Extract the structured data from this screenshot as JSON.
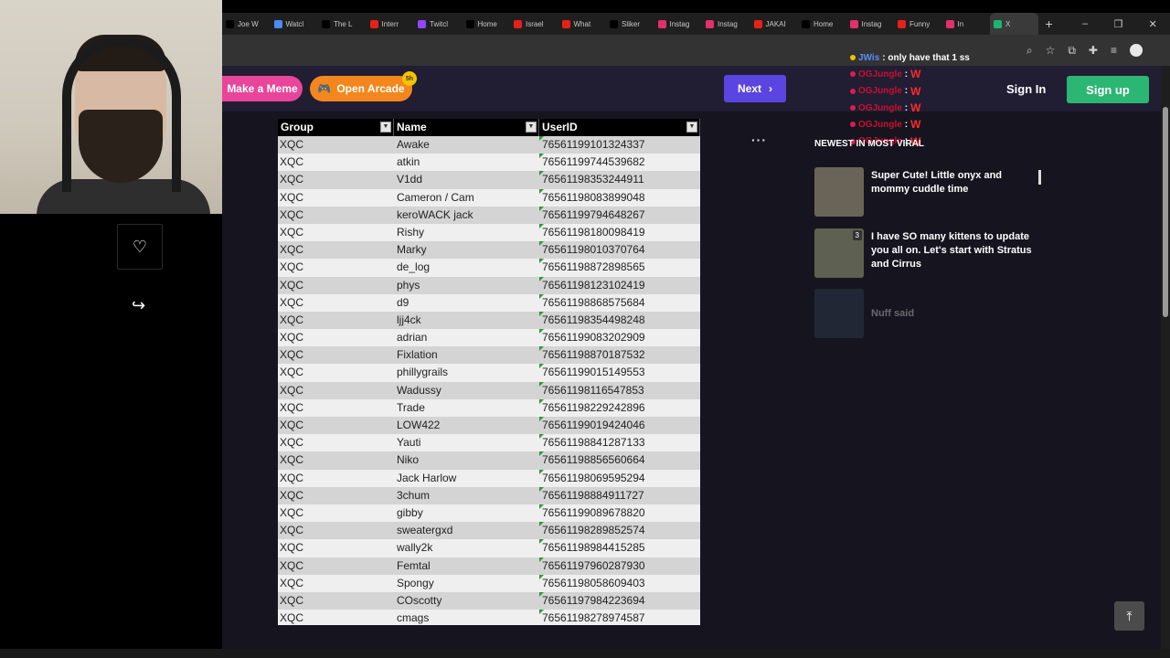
{
  "browser": {
    "tabs": [
      {
        "label": "Joe W",
        "icon": "x-logo-icon",
        "color": "#000000"
      },
      {
        "label": "Watcl",
        "icon": "globe-icon",
        "color": "#4a8cf0"
      },
      {
        "label": "The L",
        "icon": "tiktok-icon",
        "color": "#000000"
      },
      {
        "label": "Interr",
        "icon": "youtube-icon",
        "color": "#e62117"
      },
      {
        "label": "Twitcl",
        "icon": "twitch-icon",
        "color": "#9146ff"
      },
      {
        "label": "Home",
        "icon": "x-logo-icon",
        "color": "#000000"
      },
      {
        "label": "Israel",
        "icon": "youtube-icon",
        "color": "#e62117"
      },
      {
        "label": "What",
        "icon": "youtube-icon",
        "color": "#e62117"
      },
      {
        "label": "Sliker",
        "icon": "tiktok-icon",
        "color": "#000000"
      },
      {
        "label": "Instag",
        "icon": "instagram-icon",
        "color": "#e1306c"
      },
      {
        "label": "Instag",
        "icon": "instagram-icon",
        "color": "#e1306c"
      },
      {
        "label": "JAKAI",
        "icon": "youtube-icon",
        "color": "#e62117"
      },
      {
        "label": "Home",
        "icon": "x-logo-icon",
        "color": "#000000"
      },
      {
        "label": "Instag",
        "icon": "instagram-icon",
        "color": "#e1306c"
      },
      {
        "label": "Funny",
        "icon": "youtube-icon",
        "color": "#e62117"
      },
      {
        "label": "In",
        "icon": "instagram-icon",
        "color": "#e1306c"
      },
      {
        "label": "X",
        "icon": "imgur-icon",
        "color": "#1bb76e"
      }
    ],
    "new_tab": "+",
    "window_controls": [
      "–",
      "❐",
      "✕"
    ]
  },
  "site": {
    "make_meme": "Make a Meme",
    "open_arcade": "Open Arcade",
    "arcade_badge": "5h",
    "next": "Next",
    "sign_in": "Sign In",
    "sign_up": "Sign up",
    "more": "···"
  },
  "sheet": {
    "headers": [
      "Group",
      "Name",
      "UserID"
    ],
    "rows": [
      [
        "XQC",
        "Awake",
        "76561199101324337"
      ],
      [
        "XQC",
        "atkin",
        "76561199744539682"
      ],
      [
        "XQC",
        "V1dd",
        "76561198353244911"
      ],
      [
        "XQC",
        "Cameron / Cam",
        "76561198083899048"
      ],
      [
        "XQC",
        "keroWACK jack",
        "76561199794648267"
      ],
      [
        "XQC",
        "Rishy",
        "76561198180098419"
      ],
      [
        "XQC",
        "Marky",
        "76561198010370764"
      ],
      [
        "XQC",
        "de_log",
        "76561198872898565"
      ],
      [
        "XQC",
        "phys",
        "76561198123102419"
      ],
      [
        "XQC",
        "d9",
        "76561198868575684"
      ],
      [
        "XQC",
        "ljj4ck",
        "76561198354498248"
      ],
      [
        "XQC",
        "adrian",
        "76561199083202909"
      ],
      [
        "XQC",
        "Fixlation",
        "76561198870187532"
      ],
      [
        "XQC",
        "phillygrails",
        "76561199015149553"
      ],
      [
        "XQC",
        "Wadussy",
        "76561198116547853"
      ],
      [
        "XQC",
        "Trade",
        "76561198229242896"
      ],
      [
        "XQC",
        "LOW422",
        "76561199019424046"
      ],
      [
        "XQC",
        "Yauti",
        "76561198841287133"
      ],
      [
        "XQC",
        "Niko",
        "76561198856560664"
      ],
      [
        "XQC",
        "Jack Harlow",
        "76561198069595294"
      ],
      [
        "XQC",
        "3chum",
        "76561198884911727"
      ],
      [
        "XQC",
        "gibby",
        "76561199089678820"
      ],
      [
        "XQC",
        "sweatergxd",
        "76561198289852574"
      ],
      [
        "XQC",
        "wally2k",
        "76561198984415285"
      ],
      [
        "XQC",
        "Femtal",
        "76561197960287930"
      ],
      [
        "XQC",
        "Spongy",
        "76561198058609403"
      ],
      [
        "XQC",
        "COscotty",
        "76561197984223694"
      ],
      [
        "XQC",
        "cmags",
        "76561198278974587"
      ]
    ]
  },
  "chat": [
    {
      "user": "JWis",
      "msg": ": only have that 1 ss",
      "user_color": "blue"
    },
    {
      "user": "OGJungle",
      "msg": "W",
      "user_color": "red"
    },
    {
      "user": "OGJungle",
      "msg": "W",
      "user_color": "red"
    },
    {
      "user": "OGJungle",
      "msg": "W",
      "user_color": "red"
    },
    {
      "user": "OGJungle",
      "msg": "W",
      "user_color": "red"
    },
    {
      "user": "OGJungle",
      "msg": "W",
      "user_color": "red"
    }
  ],
  "viral": {
    "title": "NEWEST IN MOST VIRAL",
    "items": [
      {
        "text": "Super Cute! Little onyx and mommy cuddle time",
        "count": ""
      },
      {
        "text": "I have SO many kittens to update you all on. Let's start with Stratus and Cirrus",
        "count": "3"
      },
      {
        "text": "Nuff said",
        "count": ""
      }
    ]
  }
}
